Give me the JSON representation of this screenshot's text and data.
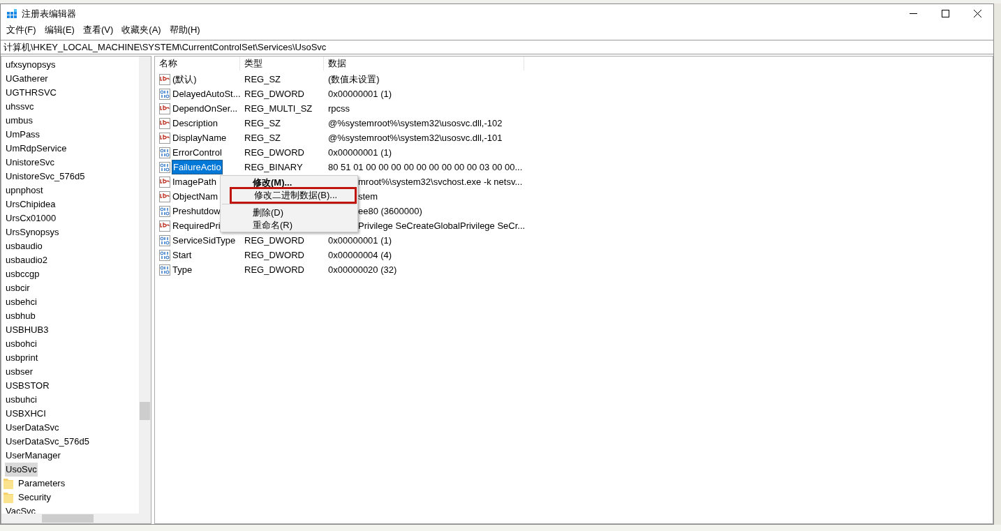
{
  "window": {
    "title": "注册表编辑器"
  },
  "menu": [
    "文件(F)",
    "编辑(E)",
    "查看(V)",
    "收藏夹(A)",
    "帮助(H)"
  ],
  "address": "计算机\\HKEY_LOCAL_MACHINE\\SYSTEM\\CurrentControlSet\\Services\\UsoSvc",
  "tree": [
    {
      "label": "ufxsynopsys",
      "selected": false
    },
    {
      "label": "UGatherer",
      "selected": false
    },
    {
      "label": "UGTHRSVC",
      "selected": false
    },
    {
      "label": "uhssvc",
      "selected": false
    },
    {
      "label": "umbus",
      "selected": false
    },
    {
      "label": "UmPass",
      "selected": false
    },
    {
      "label": "UmRdpService",
      "selected": false
    },
    {
      "label": "UnistoreSvc",
      "selected": false
    },
    {
      "label": "UnistoreSvc_576d5",
      "selected": false
    },
    {
      "label": "upnphost",
      "selected": false
    },
    {
      "label": "UrsChipidea",
      "selected": false
    },
    {
      "label": "UrsCx01000",
      "selected": false
    },
    {
      "label": "UrsSynopsys",
      "selected": false
    },
    {
      "label": "usbaudio",
      "selected": false
    },
    {
      "label": "usbaudio2",
      "selected": false
    },
    {
      "label": "usbccgp",
      "selected": false
    },
    {
      "label": "usbcir",
      "selected": false
    },
    {
      "label": "usbehci",
      "selected": false
    },
    {
      "label": "usbhub",
      "selected": false
    },
    {
      "label": "USBHUB3",
      "selected": false
    },
    {
      "label": "usbohci",
      "selected": false
    },
    {
      "label": "usbprint",
      "selected": false
    },
    {
      "label": "usbser",
      "selected": false
    },
    {
      "label": "USBSTOR",
      "selected": false
    },
    {
      "label": "usbuhci",
      "selected": false
    },
    {
      "label": "USBXHCI",
      "selected": false
    },
    {
      "label": "UserDataSvc",
      "selected": false
    },
    {
      "label": "UserDataSvc_576d5",
      "selected": false
    },
    {
      "label": "UserManager",
      "selected": false
    },
    {
      "label": "UsoSvc",
      "selected": true,
      "children": [
        {
          "label": "Parameters",
          "selected": false
        },
        {
          "label": "Security",
          "selected": false
        }
      ]
    },
    {
      "label": "VacSvc",
      "selected": false
    }
  ],
  "columns": [
    "名称",
    "类型",
    "数据"
  ],
  "values": [
    {
      "kind": "string",
      "name": "(默认)",
      "type": "REG_SZ",
      "data": "(数值未设置)",
      "selected": false,
      "covered_by_menu": false
    },
    {
      "kind": "binary",
      "name": "DelayedAutoSt...",
      "type": "REG_DWORD",
      "data": "0x00000001 (1)",
      "selected": false,
      "covered_by_menu": false
    },
    {
      "kind": "string",
      "name": "DependOnSer...",
      "type": "REG_MULTI_SZ",
      "data": "rpcss",
      "selected": false,
      "covered_by_menu": false
    },
    {
      "kind": "string",
      "name": "Description",
      "type": "REG_SZ",
      "data": "@%systemroot%\\system32\\usosvc.dll,-102",
      "selected": false,
      "covered_by_menu": false
    },
    {
      "kind": "string",
      "name": "DisplayName",
      "type": "REG_SZ",
      "data": "@%systemroot%\\system32\\usosvc.dll,-101",
      "selected": false,
      "covered_by_menu": false
    },
    {
      "kind": "binary",
      "name": "ErrorControl",
      "type": "REG_DWORD",
      "data": "0x00000001 (1)",
      "selected": false,
      "covered_by_menu": false
    },
    {
      "kind": "binary",
      "name": "FailureActio",
      "type": "REG_BINARY",
      "data": "80 51 01 00 00 00 00 00 00 00 00 00 03 00 00...",
      "selected": true,
      "covered_by_menu": false
    },
    {
      "kind": "string",
      "name": "ImagePath",
      "data": "mroot%\\system32\\svchost.exe -k netsv...",
      "selected": false,
      "covered_by_menu": true
    },
    {
      "kind": "string",
      "name": "ObjectNam",
      "data": "stem",
      "selected": false,
      "covered_by_menu": true
    },
    {
      "kind": "binary",
      "name": "Preshutdow",
      "data": "ee80 (3600000)",
      "selected": false,
      "covered_by_menu": true
    },
    {
      "kind": "string",
      "name": "RequiredPri",
      "data": "Privilege SeCreateGlobalPrivilege SeCr...",
      "selected": false,
      "covered_by_menu": true
    },
    {
      "kind": "binary",
      "name": "ServiceSidType",
      "type": "REG_DWORD",
      "data": "0x00000001 (1)",
      "selected": false,
      "covered_by_menu": false
    },
    {
      "kind": "binary",
      "name": "Start",
      "type": "REG_DWORD",
      "data": "0x00000004 (4)",
      "selected": false,
      "covered_by_menu": false
    },
    {
      "kind": "binary",
      "name": "Type",
      "type": "REG_DWORD",
      "data": "0x00000020 (32)",
      "selected": false,
      "covered_by_menu": false
    }
  ],
  "context_menu": [
    {
      "kind": "item",
      "label": "修改(M)...",
      "bold": true,
      "highlighted": false
    },
    {
      "kind": "item",
      "label": "修改二进制数据(B)...",
      "bold": false,
      "highlighted": true
    },
    {
      "kind": "separator"
    },
    {
      "kind": "item",
      "label": "删除(D)",
      "bold": false,
      "highlighted": false
    },
    {
      "kind": "item",
      "label": "重命名(R)",
      "bold": false,
      "highlighted": false
    }
  ]
}
